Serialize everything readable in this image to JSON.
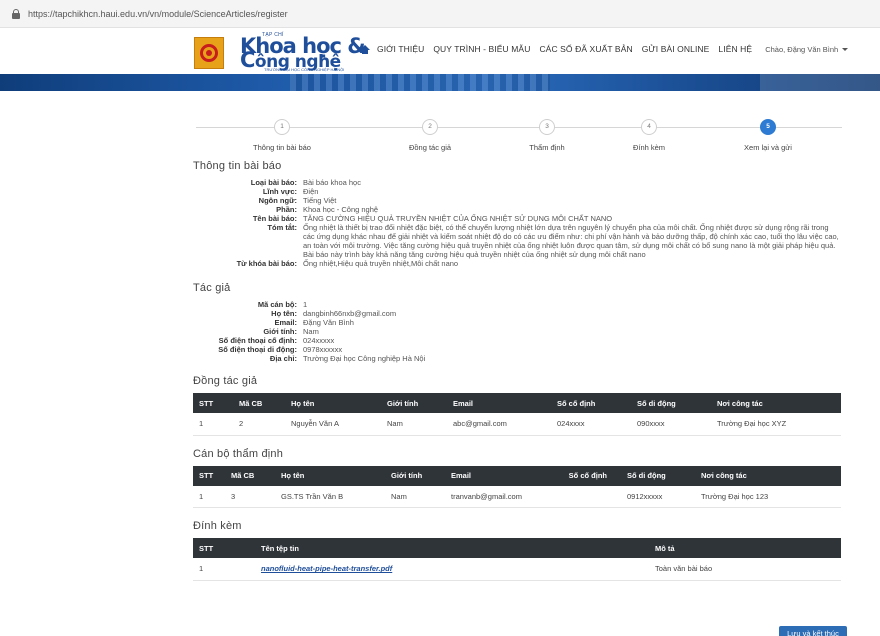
{
  "browser": {
    "url": "https://tapchikhcn.haui.edu.vn/vn/module/ScienceArticles/register"
  },
  "logo": {
    "small": "TẠP CHÍ",
    "line1": "Khoa học &",
    "line2_big": "C",
    "line2_rest": "ông nghệ",
    "tiny": "TRƯỜNG ĐẠI HỌC CÔNG NGHIỆP HÀ NỘI"
  },
  "nav": {
    "items": [
      "GIỚI THIỆU",
      "QUY TRÌNH - BIỂU MẪU",
      "CÁC SỐ ĐÃ XUẤT BẢN",
      "GỬI BÀI ONLINE",
      "LIÊN HỆ"
    ],
    "user": "Chào, Đặng Văn Bình"
  },
  "steps": [
    {
      "num": "1",
      "label": "Thông tin bài báo"
    },
    {
      "num": "2",
      "label": "Đồng tác giả"
    },
    {
      "num": "3",
      "label": "Thẩm định"
    },
    {
      "num": "4",
      "label": "Đính kèm"
    },
    {
      "num": "5",
      "label": "Xem lại và gửi"
    }
  ],
  "article": {
    "title": "Thông tin bài báo",
    "fields": [
      {
        "k": "Loại bài báo:",
        "v": "Bài báo khoa học"
      },
      {
        "k": "Lĩnh vực:",
        "v": "Điện"
      },
      {
        "k": "Ngôn ngữ:",
        "v": "Tiếng Việt"
      },
      {
        "k": "Phần:",
        "v": "Khoa học - Công nghệ"
      },
      {
        "k": "Tên bài báo:",
        "v": "TĂNG CƯỜNG HIỆU QUẢ TRUYỀN NHIỆT CỦA ỐNG NHIỆT SỬ DỤNG MÔI CHẤT NANO"
      },
      {
        "k": "Tóm tắt:",
        "v": "Ống nhiệt là thiết bị trao đổi nhiệt đặc biệt, có thể chuyển lượng nhiệt lớn dựa trên nguyên lý chuyển pha của môi chất. Ống nhiệt được sử dụng rộng rãi trong các ứng dụng khác nhau để giải nhiệt và kiểm soát nhiệt độ do có các ưu điểm như: chi phí vận hành và bảo dưỡng thấp, độ chính xác cao, tuổi thọ lâu việc cao, an toàn với môi trường. Việc tăng cường hiệu quả truyền nhiệt của ống nhiệt luôn được quan tâm, sử dụng môi chất có bổ sung nano là một giải pháp hiệu quả. Bài báo này trình bày khả năng tăng cường hiệu quả truyền nhiệt của ống nhiệt sử dụng môi chất nano"
      },
      {
        "k": "Từ khóa bài báo:",
        "v": "Ống nhiệt,Hiệu quả truyền nhiệt,Môi chất nano"
      }
    ]
  },
  "author": {
    "title": "Tác giả",
    "fields": [
      {
        "k": "Mã cán bộ:",
        "v": "1"
      },
      {
        "k": "Họ tên:",
        "v": "dangbinh66nxb@gmail.com"
      },
      {
        "k": "Email:",
        "v": "Đặng Văn Bình"
      },
      {
        "k": "Giới tính:",
        "v": "Nam"
      },
      {
        "k": "Số điện thoại cố định:",
        "v": "024xxxxx"
      },
      {
        "k": "Số điện thoại di động:",
        "v": "0978xxxxxx"
      },
      {
        "k": "Địa chỉ:",
        "v": "Trường Đại học Công nghiệp Hà Nội"
      }
    ]
  },
  "coauthors": {
    "title": "Đồng tác giả",
    "headers": [
      "STT",
      "Mã CB",
      "Họ tên",
      "Giới tính",
      "Email",
      "Số cố định",
      "Số di động",
      "Nơi công tác"
    ],
    "rows": [
      [
        "1",
        "2",
        "Nguyễn Văn A",
        "Nam",
        "abc@gmail.com",
        "024xxxx",
        "090xxxx",
        "Trường Đại học XYZ"
      ]
    ]
  },
  "reviewers": {
    "title": "Cán bộ thẩm định",
    "headers": [
      "STT",
      "Mã CB",
      "Họ tên",
      "Giới tính",
      "Email",
      "Số cố định",
      "Số di động",
      "Nơi công tác"
    ],
    "rows": [
      [
        "1",
        "3",
        "GS.TS Trần Văn B",
        "Nam",
        "tranvanb@gmail.com",
        "",
        "0912xxxxx",
        "Trường Đại học 123"
      ]
    ]
  },
  "attachments": {
    "title": "Đính kèm",
    "headers": [
      "STT",
      "Tên tệp tin",
      "Mô tả"
    ],
    "rows": [
      [
        "1",
        "nanofluid-heat-pipe-heat-transfer.pdf",
        "Toàn văn bài báo"
      ]
    ]
  },
  "actions": {
    "save": "Lưu và kết thúc"
  }
}
